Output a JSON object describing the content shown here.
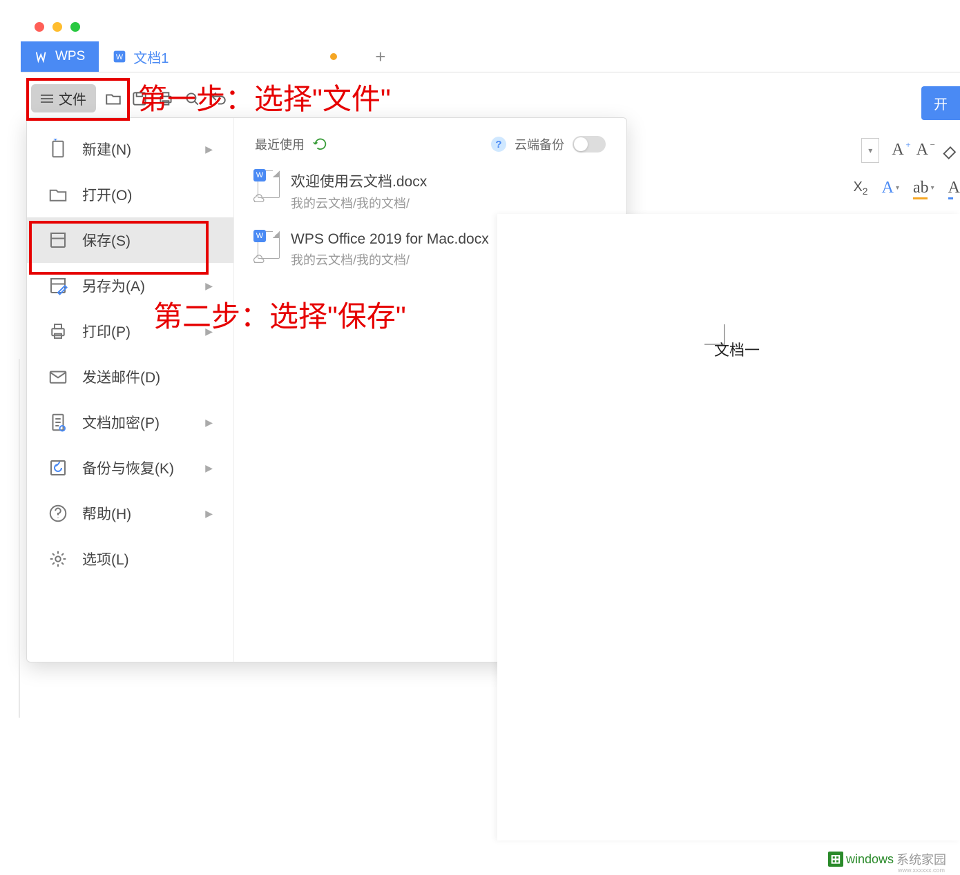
{
  "window": {
    "tabs": {
      "wps_label": "WPS",
      "doc_label": "文档1",
      "add_label": "+"
    }
  },
  "toolbar": {
    "file_label": "文件",
    "open_button": "开"
  },
  "annotations": {
    "step1": "第一步：选择\"文件\"",
    "step2": "第二步：选择\"保存\""
  },
  "file_menu": {
    "items": [
      {
        "label": "新建(N)",
        "has_arrow": true
      },
      {
        "label": "打开(O)",
        "has_arrow": false
      },
      {
        "label": "保存(S)",
        "has_arrow": false,
        "selected": true
      },
      {
        "label": "另存为(A)",
        "has_arrow": true
      },
      {
        "label": "打印(P)",
        "has_arrow": true
      },
      {
        "label": "发送邮件(D)",
        "has_arrow": false
      },
      {
        "label": "文档加密(P)",
        "has_arrow": true
      },
      {
        "label": "备份与恢复(K)",
        "has_arrow": true
      },
      {
        "label": "帮助(H)",
        "has_arrow": true
      },
      {
        "label": "选项(L)",
        "has_arrow": false
      }
    ],
    "recent": {
      "header": "最近使用",
      "cloud_backup_label": "云端备份",
      "files": [
        {
          "name": "欢迎使用云文档.docx",
          "path": "我的云文档/我的文档/"
        },
        {
          "name": "WPS Office 2019 for Mac.docx",
          "path": "我的云文档/我的文档/"
        }
      ]
    }
  },
  "document": {
    "title": "文档一"
  },
  "format": {
    "A_plus": "A",
    "A_minus": "A",
    "x2": "X",
    "ab": "ab",
    "A_under": "A",
    "A_red": "A"
  },
  "watermark": {
    "brand": "windows",
    "suffix": "系统家园",
    "sub": "www.xxxxxx.com"
  }
}
